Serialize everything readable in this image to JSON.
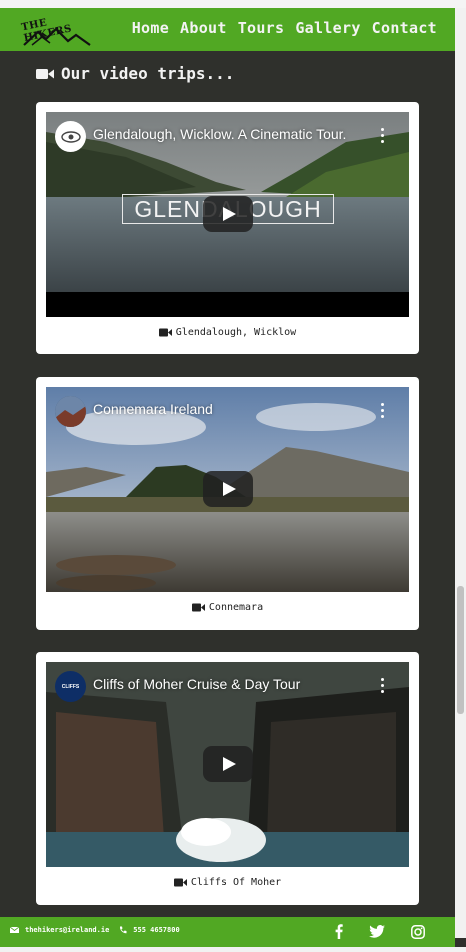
{
  "brand": {
    "logo_text": "THE HIKERS"
  },
  "nav": {
    "items": [
      {
        "label": "Home"
      },
      {
        "label": "About"
      },
      {
        "label": "Tours"
      },
      {
        "label": "Gallery"
      },
      {
        "label": "Contact"
      }
    ]
  },
  "section": {
    "title": "Our video trips...",
    "icon": "video-camera-icon"
  },
  "videos": [
    {
      "title": "Glendalough, Wicklow. A Cinematic Tour.",
      "overlay_text": "GLENDALOUGH",
      "caption": "Glendalough, Wicklow"
    },
    {
      "title": "Connemara Ireland",
      "caption": "Connemara"
    },
    {
      "title": "Cliffs of Moher Cruise & Day Tour",
      "channel_badge": "CLIFFS",
      "caption": "Cliffs Of Moher"
    }
  ],
  "footer": {
    "email": "thehikers@ireland.ie",
    "phone": "555 4657800",
    "social": [
      "facebook-icon",
      "twitter-icon",
      "instagram-icon"
    ]
  },
  "colors": {
    "brand_green": "#51a823",
    "page_bg": "#2f302c"
  }
}
